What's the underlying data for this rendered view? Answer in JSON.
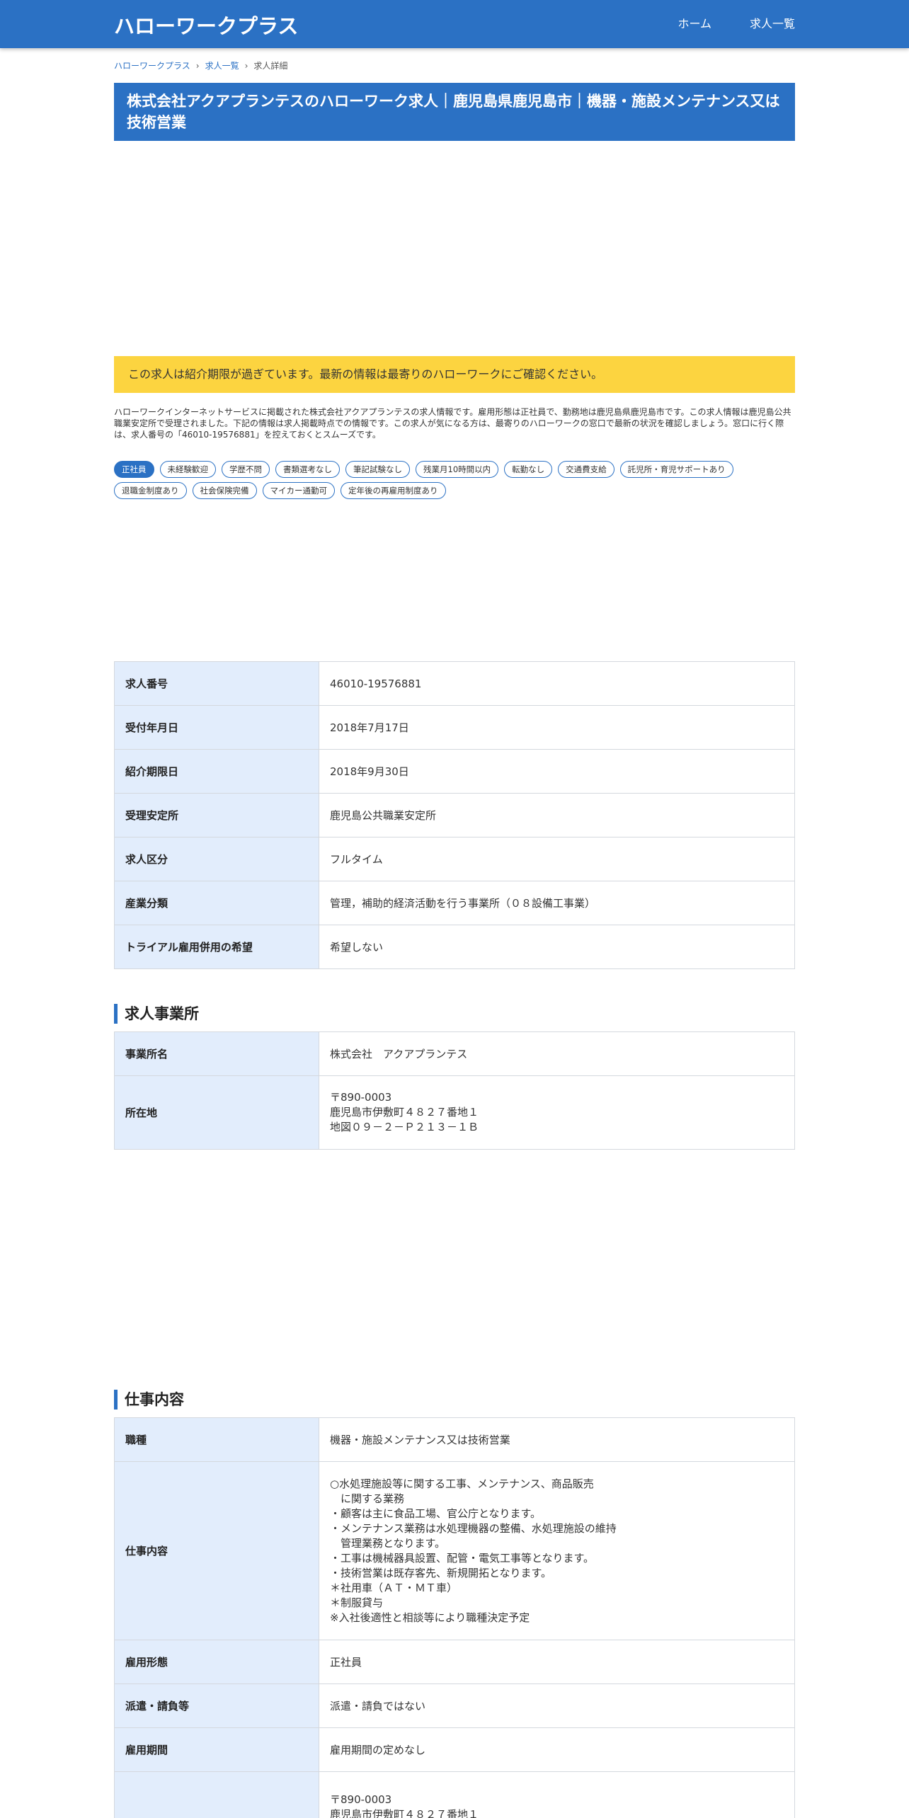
{
  "header": {
    "brand": "ハローワークプラス",
    "nav": [
      "ホーム",
      "求人一覧"
    ]
  },
  "breadcrumb": [
    "ハローワークプラス",
    "求人一覧",
    "求人詳細"
  ],
  "title": "株式会社アクアプランテスのハローワーク求人｜鹿児島県鹿児島市｜機器・施設メンテナンス又は技術営業",
  "alert": "この求人は紹介期限が過ぎています。最新の情報は最寄りのハローワークにご確認ください。",
  "intro": "ハローワークインターネットサービスに掲載された株式会社アクアプランテスの求人情報です。雇用形態は正社員で、勤務地は鹿児島県鹿児島市です。この求人情報は鹿児島公共職業安定所で受理されました。下記の情報は求人掲載時点での情報です。この求人が気になる方は、最寄りのハローワークの窓口で最新の状況を確認しましょう。窓口に行く際は、求人番号の「46010-19576881」を控えておくとスムーズです。",
  "tags": [
    "正社員",
    "未経験歓迎",
    "学歴不問",
    "書類選考なし",
    "筆記試験なし",
    "残業月10時間以内",
    "転勤なし",
    "交通費支給",
    "託児所・育児サポートあり",
    "退職金制度あり",
    "社会保険完備",
    "マイカー通勤可",
    "定年後の再雇用制度あり"
  ],
  "basic_info": [
    {
      "label": "求人番号",
      "value": "46010-19576881"
    },
    {
      "label": "受付年月日",
      "value": "2018年7月17日"
    },
    {
      "label": "紹介期限日",
      "value": "2018年9月30日"
    },
    {
      "label": "受理安定所",
      "value": "鹿児島公共職業安定所"
    },
    {
      "label": "求人区分",
      "value": "フルタイム"
    },
    {
      "label": "産業分類",
      "value": "管理，補助的経済活動を行う事業所（０８設備工事業）"
    },
    {
      "label": "トライアル雇用併用の希望",
      "value": "希望しない"
    }
  ],
  "office_section": {
    "title": "求人事業所",
    "rows": [
      {
        "label": "事業所名",
        "value": "株式会社　アクアプランテス"
      },
      {
        "label": "所在地",
        "value": "〒890-0003\n鹿児島市伊敷町４８２７番地１\n地図０９－２－Ｐ２１３－１Ｂ"
      }
    ]
  },
  "job_section": {
    "title": "仕事内容",
    "rows": [
      {
        "label": "職種",
        "value": "機器・施設メンテナンス又は技術営業"
      },
      {
        "label": "仕事内容",
        "value": "○水処理施設等に関する工事、メンテナンス、商品販売\n　に関する業務\n・顧客は主に食品工場、官公庁となります。\n・メンテナンス業務は水処理機器の整備、水処理施設の維持\n　管理業務となります。\n・工事は機械器具設置、配管・電気工事等となります。\n・技術営業は既存客先、新規開拓となります。\n＊社用車（ＡＴ・ＭＴ車）\n＊制服貸与\n※入社後適性と相談等により職種決定予定"
      },
      {
        "label": "雇用形態",
        "value": "正社員"
      },
      {
        "label": "派遣・請負等",
        "value": "派遣・請負ではない"
      },
      {
        "label": "雇用期間",
        "value": "雇用期間の定めなし"
      },
      {
        "label": "",
        "value": "〒890-0003\n鹿児島市伊敷町４８２７番地１"
      }
    ]
  }
}
